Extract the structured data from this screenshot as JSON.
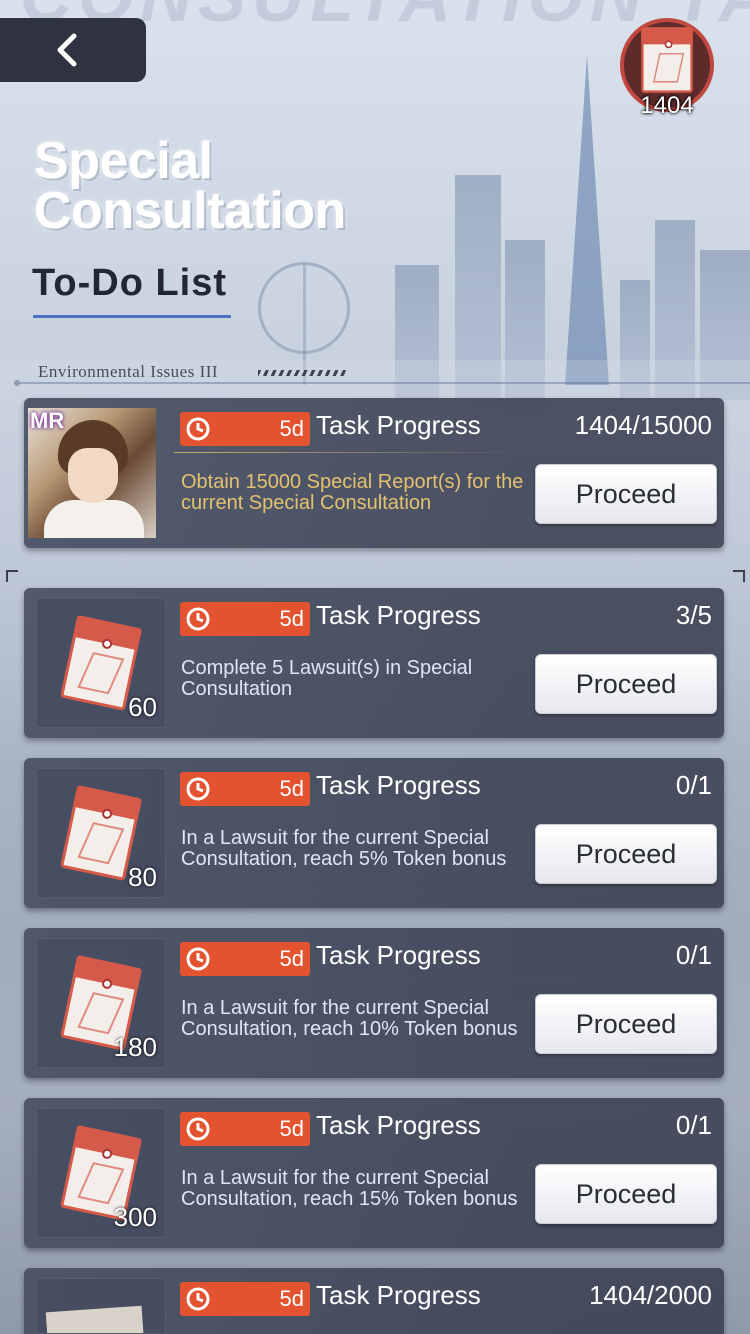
{
  "background_title": "CONSULTATION TASK",
  "currency": {
    "icon": "special-report-icon",
    "count": "1404"
  },
  "header": {
    "title_line1": "Special",
    "title_line2": "Consultation",
    "subtitle": "To-Do List",
    "section": "Environmental Issues III"
  },
  "colors": {
    "timer": "#e4532f",
    "accent_line": "#4d6fc4",
    "featured_desc": "#e4c170"
  },
  "tasks": [
    {
      "badge": "MR",
      "timer": "5d",
      "label": "Task Progress",
      "progress": "1404/15000",
      "desc": "Obtain 15000 Special Report(s) for the current Special Consultation",
      "button": "Proceed"
    },
    {
      "reward": "60",
      "timer": "5d",
      "label": "Task Progress",
      "progress": "3/5",
      "desc": "Complete 5 Lawsuit(s) in Special Consultation",
      "button": "Proceed"
    },
    {
      "reward": "80",
      "timer": "5d",
      "label": "Task Progress",
      "progress": "0/1",
      "desc": "In a Lawsuit for the current Special Consultation, reach 5% Token bonus",
      "button": "Proceed"
    },
    {
      "reward": "180",
      "timer": "5d",
      "label": "Task Progress",
      "progress": "0/1",
      "desc": "In a Lawsuit for the current Special Consultation, reach 10% Token bonus",
      "button": "Proceed"
    },
    {
      "reward": "300",
      "timer": "5d",
      "label": "Task Progress",
      "progress": "0/1",
      "desc": "In a Lawsuit for the current Special Consultation, reach 15% Token bonus",
      "button": "Proceed"
    },
    {
      "timer": "5d",
      "label": "Task Progress",
      "progress": "1404/2000"
    }
  ]
}
